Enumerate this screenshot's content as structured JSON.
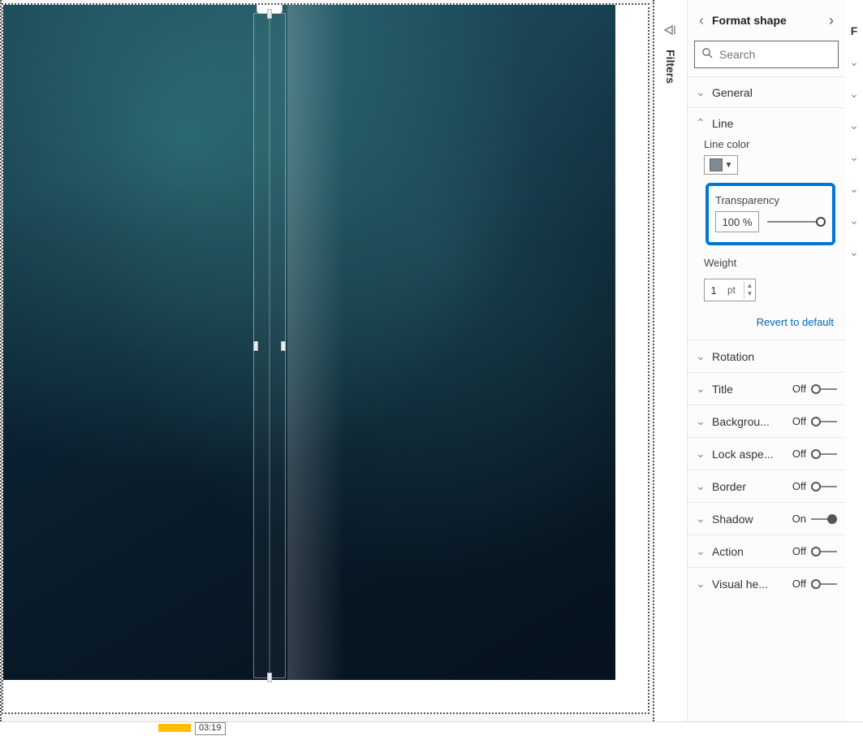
{
  "filters_rail": {
    "label": "Filters"
  },
  "canvas": {
    "context_menu": "···",
    "timestamp": "03:19"
  },
  "panel": {
    "title": "Format shape",
    "search_placeholder": "Search",
    "general": {
      "label": "General"
    },
    "line": {
      "label": "Line",
      "color_label": "Line color",
      "color_hex": "#7f8a93",
      "transparency_label": "Transparency",
      "transparency_value": "100 %",
      "weight_label": "Weight",
      "weight_value": "1",
      "weight_unit": "pt"
    },
    "revert_label": "Revert to default",
    "options": [
      {
        "name": "Rotation",
        "state": null
      },
      {
        "name": "Title",
        "state": "Off"
      },
      {
        "name": "Backgrou...",
        "state": "Off"
      },
      {
        "name": "Lock aspe...",
        "state": "Off"
      },
      {
        "name": "Border",
        "state": "Off"
      },
      {
        "name": "Shadow",
        "state": "On"
      },
      {
        "name": "Action",
        "state": "Off"
      },
      {
        "name": "Visual he...",
        "state": "Off"
      }
    ]
  }
}
